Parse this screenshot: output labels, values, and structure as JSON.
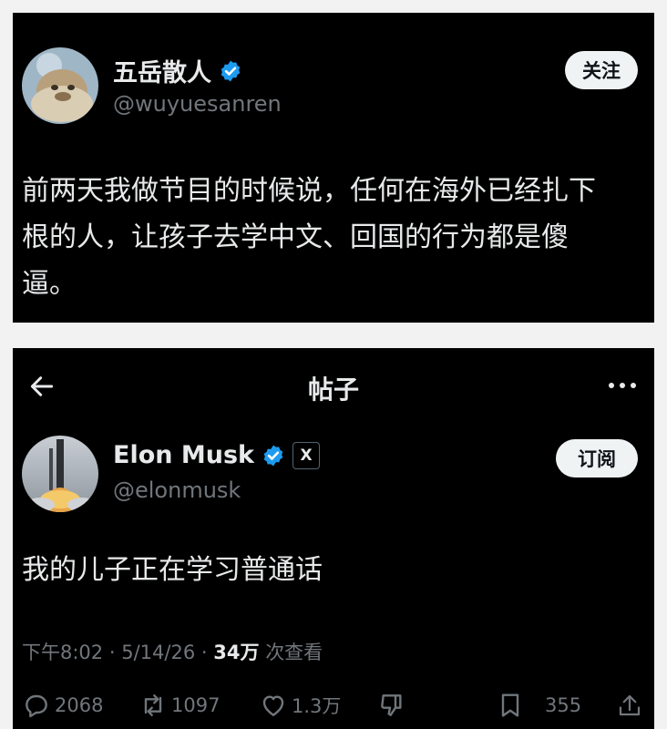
{
  "post1": {
    "display_name": "五岳散人",
    "handle": "@wuyuesanren",
    "follow_label": "关注",
    "text_lines": [
      "前两天我做节目的时候说，任何在海外已经扎下",
      "根的人，让孩子去学中文、回国的行为都是傻",
      "逼。"
    ]
  },
  "post2": {
    "nav": {
      "title": "帖子"
    },
    "display_name": "Elon Musk",
    "x_badge": "X",
    "handle": "@elonmusk",
    "follow_label": "订阅",
    "text": "我的儿子正在学习普通话",
    "meta": {
      "time": "下午8:02",
      "sep1": "·",
      "date": "5/14/26",
      "sep2": "·",
      "views": "34万",
      "views_label": "次查看"
    },
    "actions": {
      "replies": "2068",
      "reposts": "1097",
      "likes": "1.3万",
      "bookmarks": "355"
    }
  },
  "colors": {
    "background": "#000000",
    "verified": "#1d9bf0",
    "muted": "#71767b",
    "text": "#e7e9ea",
    "button_bg": "#eff3f4"
  }
}
